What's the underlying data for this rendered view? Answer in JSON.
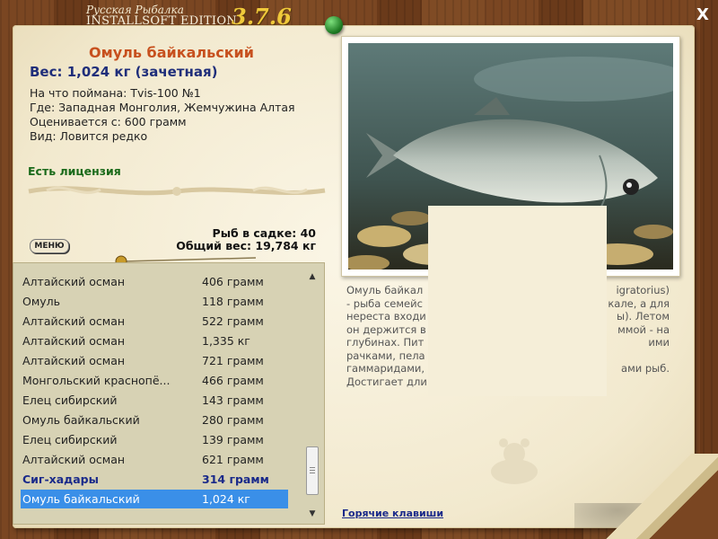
{
  "brand": {
    "line1": "Русская Рыбалка",
    "line2": "INSTALLSOFT EDITION",
    "version": "3.7.6"
  },
  "close_label": "X",
  "fish": {
    "name": "Омуль байкальский",
    "weight": "Вес: 1,024 кг (зачетная)",
    "info": [
      "На что поймана: Tvis-100 №1",
      "Где: Западная Монголия, Жемчужина Алтая",
      "Оценивается с: 600 грамм",
      "Вид: Ловится редко"
    ],
    "license": "Есть лицензия"
  },
  "totals": {
    "count": "Рыб в садке: 40",
    "weight": "Общий вес: 19,784 кг"
  },
  "menu_label": "МЕНЮ",
  "catch_list": [
    {
      "name": "Алтайский осман",
      "weight": "406 грамм",
      "style": "normal"
    },
    {
      "name": "Омуль",
      "weight": "118 грамм",
      "style": "normal"
    },
    {
      "name": "Алтайский осман",
      "weight": "522 грамм",
      "style": "normal"
    },
    {
      "name": "Алтайский осман",
      "weight": "1,335 кг",
      "style": "normal"
    },
    {
      "name": "Алтайский осман",
      "weight": "721 грамм",
      "style": "normal"
    },
    {
      "name": "Монгольский краснопё...",
      "weight": "466 грамм",
      "style": "normal"
    },
    {
      "name": "Елец сибирский",
      "weight": "143 грамм",
      "style": "normal"
    },
    {
      "name": "Омуль байкальский",
      "weight": "280 грамм",
      "style": "normal"
    },
    {
      "name": "Елец сибирский",
      "weight": "139 грамм",
      "style": "normal"
    },
    {
      "name": "Алтайский осман",
      "weight": "621 грамм",
      "style": "normal"
    },
    {
      "name": "Сиг-хадары",
      "weight": "314 грамм",
      "style": "bold"
    },
    {
      "name": "Омуль байкальский",
      "weight": "1,024 кг",
      "style": "selected"
    }
  ],
  "description_lines": [
    {
      "left": "Омуль байкал",
      "right": "igratorius)"
    },
    {
      "left": "- рыба семейс",
      "right": "кале, а для"
    },
    {
      "left": "нереста входи",
      "right": "ы). Летом"
    },
    {
      "left": "он держится в",
      "right": "ммой - на"
    },
    {
      "left": "глубинах. Пит",
      "right": "ими"
    },
    {
      "left": "рачками, пела",
      "right": ""
    },
    {
      "left": "гаммаридами,",
      "right": "ами рыб."
    },
    {
      "left": "Достигает дли",
      "right": ""
    }
  ],
  "hotkeys_label": "Горячие клавиши",
  "colors": {
    "title": "#c7501e",
    "weight": "#1f2e7a",
    "license": "#1a6a1a",
    "selection": "#3a8fe8"
  }
}
